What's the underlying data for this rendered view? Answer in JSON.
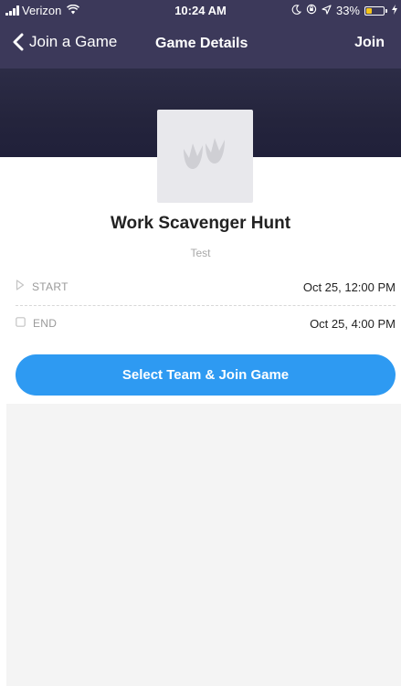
{
  "status_bar": {
    "carrier": "Verizon",
    "time": "10:24 AM",
    "battery_percent": "33%",
    "battery_level": 0.33,
    "battery_color": "#f5c518"
  },
  "nav": {
    "back_label": "Join a Game",
    "title": "Game Details",
    "join_label": "Join",
    "background": "#3c395a"
  },
  "game": {
    "image_icon": "footprints-icon",
    "title": "Work Scavenger Hunt",
    "subtitle": "Test"
  },
  "details": {
    "start": {
      "icon": "play-outline-icon",
      "label": "START",
      "value": "Oct 25, 12:00 PM"
    },
    "end": {
      "icon": "square-outline-icon",
      "label": "END",
      "value": "Oct 25, 4:00 PM"
    }
  },
  "actions": {
    "select_team_label": "Select Team & Join Game",
    "accent": "#2e9af2"
  }
}
